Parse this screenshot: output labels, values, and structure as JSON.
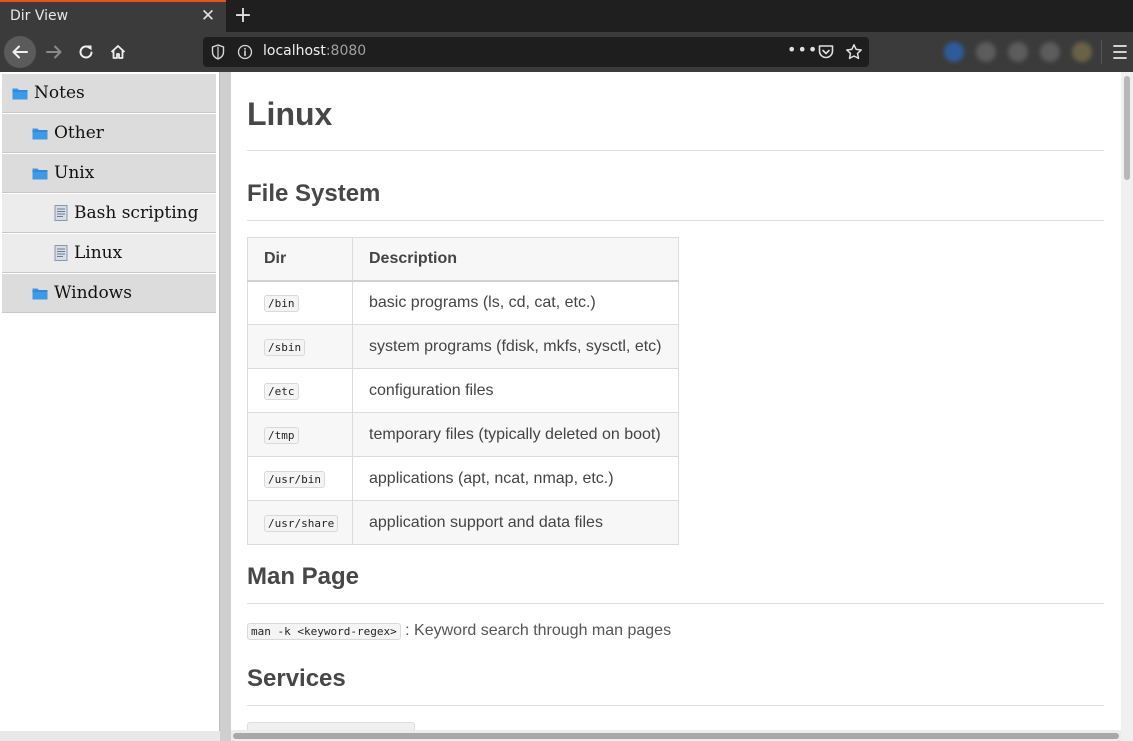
{
  "browser": {
    "tab_title": "Dir View",
    "tab_close": "✕",
    "new_tab": "+",
    "url_host": "localhost",
    "url_port": ":8080",
    "page_actions": "•••"
  },
  "sidebar": {
    "items": [
      {
        "label": "Notes",
        "type": "folder",
        "level": 0
      },
      {
        "label": "Other",
        "type": "folder",
        "level": 1
      },
      {
        "label": "Unix",
        "type": "folder",
        "level": 1
      },
      {
        "label": "Bash scripting",
        "type": "file",
        "level": 2
      },
      {
        "label": "Linux",
        "type": "file",
        "level": 2
      },
      {
        "label": "Windows",
        "type": "folder",
        "level": 1
      }
    ]
  },
  "page": {
    "title": "Linux",
    "file_system": {
      "heading": "File System",
      "headers": [
        "Dir",
        "Description"
      ],
      "rows": [
        {
          "dir": "/bin",
          "description": "basic programs (ls, cd, cat, etc.)"
        },
        {
          "dir": "/sbin",
          "description": "system programs (fdisk, mkfs, sysctl, etc)"
        },
        {
          "dir": "/etc",
          "description": "configuration files"
        },
        {
          "dir": "/tmp",
          "description": "temporary files (typically deleted on boot)"
        },
        {
          "dir": "/usr/bin",
          "description": "applications (apt, ncat, nmap, etc.)"
        },
        {
          "dir": "/usr/share",
          "description": "application support and data files"
        }
      ]
    },
    "man_page": {
      "heading": "Man Page",
      "command": "man -k <keyword-regex>",
      "text": " : Keyword search through man pages"
    },
    "services": {
      "heading": "Services"
    }
  },
  "colors": {
    "accent_tab": "#e8541c",
    "folder_icon": "#3d9ae8",
    "chrome_bg": "#3b3b3b"
  }
}
